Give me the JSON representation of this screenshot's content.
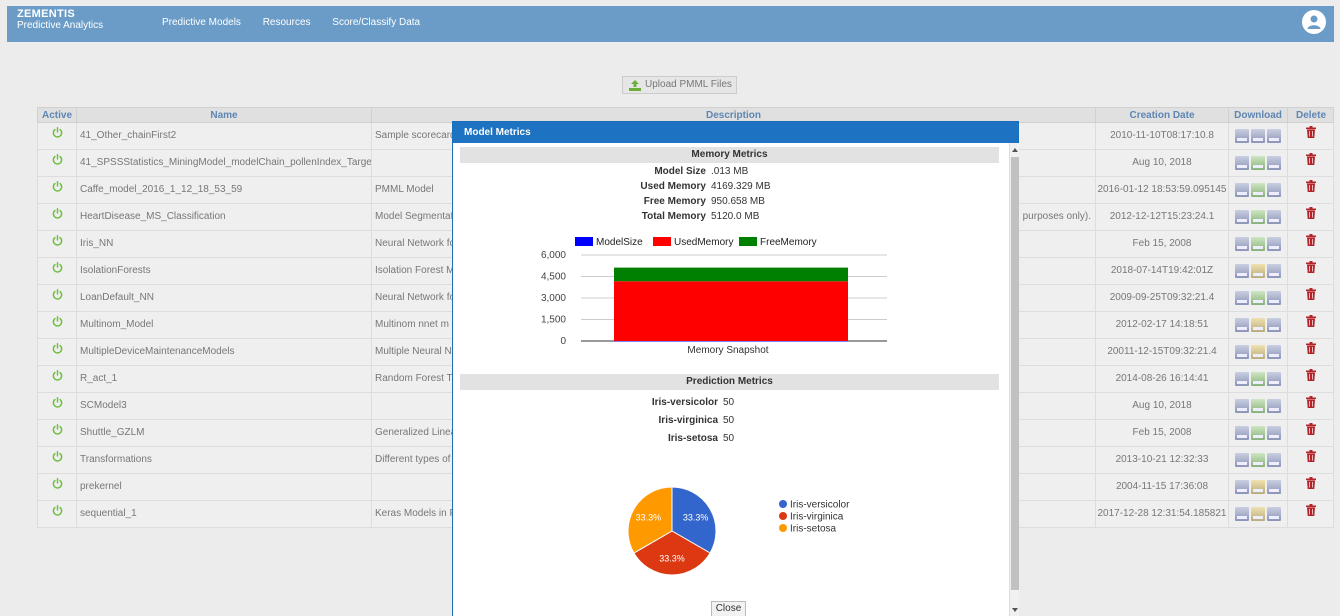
{
  "header": {
    "brand_line1": "ZEMENTIS",
    "brand_line2": "Predictive Analytics",
    "nav": [
      "Predictive Models",
      "Resources",
      "Score/Classify Data"
    ]
  },
  "upload": {
    "label": "Upload PMML Files"
  },
  "table": {
    "columns": [
      "Active",
      "Name",
      "Description",
      "Creation Date",
      "Download",
      "Delete"
    ],
    "rows": [
      {
        "name": "41_Other_chainFirst2",
        "desc": "Sample scorecard",
        "date": "2010-11-10T08:17:10.8",
        "dl": [
          "b",
          "b",
          "b"
        ]
      },
      {
        "name": "41_SPSSStatistics_MiningModel_modelChain_pollenIndex_Target",
        "desc": "",
        "date": "Aug 10, 2018",
        "dl": [
          "b",
          "g",
          "b"
        ]
      },
      {
        "name": "Caffe_model_2016_1_12_18_53_59",
        "desc": "PMML Model",
        "date": "2016-01-12 18:53:59.095145",
        "dl": [
          "b",
          "g",
          "b"
        ]
      },
      {
        "name": "HeartDisease_MS_Classification",
        "desc": "Model Segmentat",
        "desc_right": "purposes only).",
        "date": "2012-12-12T15:23:24.1",
        "dl": [
          "b",
          "g",
          "b"
        ]
      },
      {
        "name": "Iris_NN",
        "desc": "Neural Network fo",
        "date": "Feb 15, 2008",
        "dl": [
          "b",
          "g",
          "b"
        ]
      },
      {
        "name": "IsolationForests",
        "desc": "Isolation Forest M",
        "date": "2018-07-14T19:42:01Z",
        "dl": [
          "b",
          "y",
          "b"
        ]
      },
      {
        "name": "LoanDefault_NN",
        "desc": "Neural Network fo",
        "date": "2009-09-25T09:32:21.4",
        "dl": [
          "b",
          "g",
          "b"
        ]
      },
      {
        "name": "Multinom_Model",
        "desc": "Multinom nnet m",
        "date": "2012-02-17 14:18:51",
        "dl": [
          "b",
          "y",
          "b"
        ]
      },
      {
        "name": "MultipleDeviceMaintenanceModels",
        "desc": "Multiple Neural N",
        "date": "20011-12-15T09:32:21.4",
        "dl": [
          "b",
          "y",
          "b"
        ]
      },
      {
        "name": "R_act_1",
        "desc": "Random Forest T",
        "date": "2014-08-26 16:14:41",
        "dl": [
          "b",
          "g",
          "b"
        ]
      },
      {
        "name": "SCModel3",
        "desc": "",
        "date": "Aug 10, 2018",
        "dl": [
          "b",
          "g",
          "b"
        ]
      },
      {
        "name": "Shuttle_GZLM",
        "desc": "Generalized Linea",
        "date": "Feb 15, 2008",
        "dl": [
          "b",
          "g",
          "b"
        ]
      },
      {
        "name": "Transformations",
        "desc": "Different types of",
        "date": "2013-10-21 12:32:33",
        "dl": [
          "b",
          "g",
          "b"
        ]
      },
      {
        "name": "prekernel",
        "desc": "",
        "date": "2004-11-15 17:36:08",
        "dl": [
          "b",
          "y",
          "b"
        ]
      },
      {
        "name": "sequential_1",
        "desc": "Keras Models in P",
        "date": "2017-12-28 12:31:54.185821",
        "dl": [
          "b",
          "y",
          "b"
        ]
      }
    ]
  },
  "modal": {
    "title": "Model Metrics",
    "memory_section": "Memory Metrics",
    "memory": [
      {
        "k": "Model Size",
        "v": ".013 MB"
      },
      {
        "k": "Used Memory",
        "v": "4169.329 MB"
      },
      {
        "k": "Free Memory",
        "v": "950.658 MB"
      },
      {
        "k": "Total Memory",
        "v": "5120.0 MB"
      }
    ],
    "prediction_section": "Prediction Metrics",
    "prediction": [
      {
        "k": "Iris-versicolor",
        "v": "50"
      },
      {
        "k": "Iris-virginica",
        "v": "50"
      },
      {
        "k": "Iris-setosa",
        "v": "50"
      }
    ],
    "close_label": "Close"
  },
  "chart_data": [
    {
      "type": "bar",
      "stacked": true,
      "categories": [
        "Memory Snapshot"
      ],
      "series": [
        {
          "name": "ModelSize",
          "values": [
            0.013
          ],
          "color": "#0000ff"
        },
        {
          "name": "UsedMemory",
          "values": [
            4169.329
          ],
          "color": "#ff0000"
        },
        {
          "name": "FreeMemory",
          "values": [
            950.658
          ],
          "color": "#008000"
        }
      ],
      "ylim": [
        0,
        6000
      ],
      "yticks": [
        "0",
        "1,500",
        "3,000",
        "4,500",
        "6,000"
      ],
      "legend": "top"
    },
    {
      "type": "pie",
      "categories": [
        "Iris-versicolor",
        "Iris-virginica",
        "Iris-setosa"
      ],
      "values": [
        50,
        50,
        50
      ],
      "labels": [
        "33.3%",
        "33.3%",
        "33.3%"
      ],
      "colors": [
        "#3366cc",
        "#dc3912",
        "#ff9900"
      ],
      "legend": "right"
    }
  ]
}
